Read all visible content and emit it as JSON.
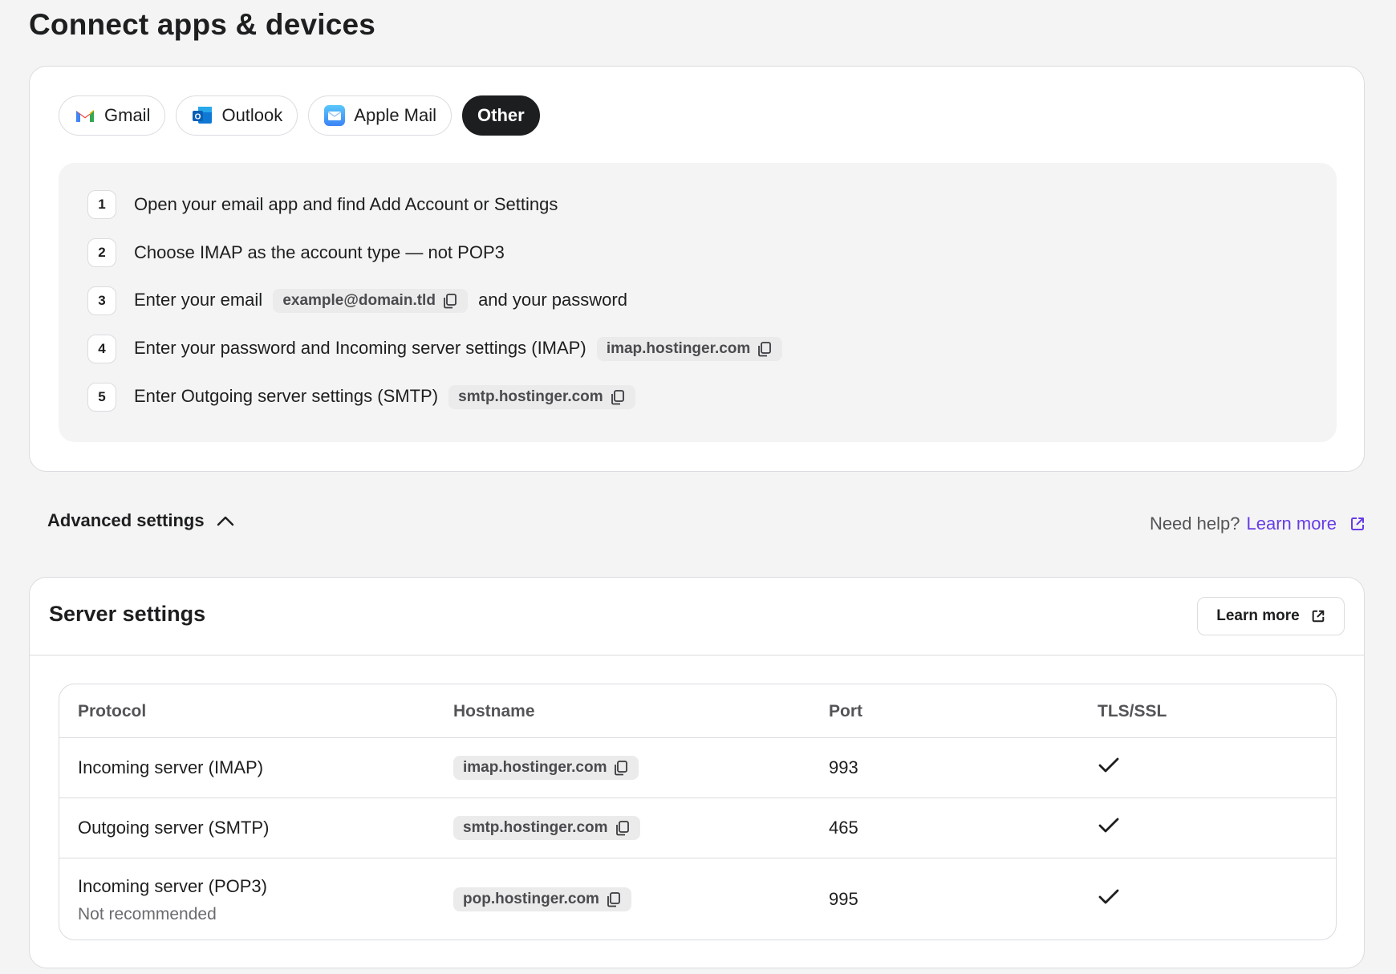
{
  "page": {
    "title": "Connect apps & devices"
  },
  "tabs": [
    {
      "label": "Gmail",
      "icon": "gmail-icon"
    },
    {
      "label": "Outlook",
      "icon": "outlook-icon"
    },
    {
      "label": "Apple Mail",
      "icon": "apple-mail-icon"
    },
    {
      "label": "Other",
      "icon": "",
      "active": true
    }
  ],
  "steps": [
    {
      "num": "1",
      "text": "Open your email app and find Add Account or Settings"
    },
    {
      "num": "2",
      "text": "Choose IMAP as the account type — not POP3"
    },
    {
      "num": "3",
      "before": "Enter your email",
      "chip": "example@domain.tld",
      "after": "and your password"
    },
    {
      "num": "4",
      "before": "Enter your password and Incoming server settings (IMAP)",
      "chip": "imap.hostinger.com"
    },
    {
      "num": "5",
      "before": "Enter Outgoing server settings (SMTP)",
      "chip": "smtp.hostinger.com"
    }
  ],
  "advanced": {
    "label": "Advanced settings",
    "expanded": true
  },
  "help": {
    "prefix": "Need help?",
    "link": "Learn more"
  },
  "server": {
    "title": "Server settings",
    "learn_more": "Learn more",
    "columns": [
      "Protocol",
      "Hostname",
      "Port",
      "TLS/SSL"
    ],
    "rows": [
      {
        "protocol": "Incoming server (IMAP)",
        "note": "",
        "host": "imap.hostinger.com",
        "port": "993",
        "tls": true
      },
      {
        "protocol": "Outgoing server (SMTP)",
        "note": "",
        "host": "smtp.hostinger.com",
        "port": "465",
        "tls": true
      },
      {
        "protocol": "Incoming server (POP3)",
        "note": "Not recommended",
        "host": "pop.hostinger.com",
        "port": "995",
        "tls": true
      }
    ]
  },
  "colors": {
    "accent": "#673de6",
    "dark": "#1d1e20",
    "border": "#dadce0",
    "background": "#f4f4f4"
  }
}
